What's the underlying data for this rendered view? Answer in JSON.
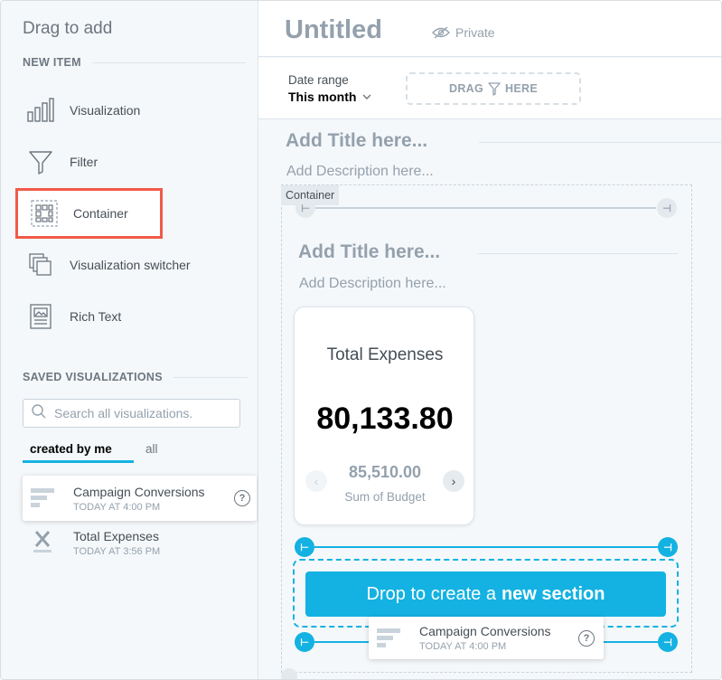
{
  "sidebar": {
    "title": "Drag to add",
    "new_item_heading": "NEW ITEM",
    "items": [
      {
        "label": "Visualization",
        "icon": "bar-chart-icon"
      },
      {
        "label": "Filter",
        "icon": "funnel-icon"
      },
      {
        "label": "Container",
        "icon": "grid-icon"
      },
      {
        "label": "Visualization switcher",
        "icon": "stacked-layers-icon"
      },
      {
        "label": "Rich Text",
        "icon": "rich-text-icon"
      }
    ],
    "saved_heading": "SAVED VISUALIZATIONS",
    "search_placeholder": "Search all visualizations.",
    "tabs": {
      "created_by_me": "created by me",
      "all": "all"
    },
    "saved_items": [
      {
        "name": "Campaign Conversions",
        "time": "TODAY AT 4:00 PM",
        "icon": "bar-chart-horizontal-icon"
      },
      {
        "name": "Total Expenses",
        "time": "TODAY AT 3:56 PM",
        "icon": "headline-x-icon"
      }
    ],
    "help_glyph": "?"
  },
  "header": {
    "title": "Untitled",
    "private_label": "Private"
  },
  "filter_bar": {
    "date_range_label": "Date range",
    "date_range_value": "This month",
    "drag_here_left": "DRAG",
    "drag_here_right": "HERE"
  },
  "section": {
    "title_placeholder": "Add Title here...",
    "description_placeholder": "Add Description here..."
  },
  "container": {
    "label": "Container",
    "title_placeholder": "Add Title here...",
    "description_placeholder": "Add Description here..."
  },
  "kpi": {
    "title": "Total Expenses",
    "value": "80,133.80",
    "previous_value": "85,510.00",
    "previous_label": "Sum of Budget"
  },
  "drop": {
    "text_prefix": "Drop to create a",
    "text_bold": "new section"
  },
  "dragging": {
    "name": "Campaign Conversions",
    "time": "TODAY AT 4:00 PM"
  },
  "colors": {
    "accent": "#14b2e2",
    "highlight": "#f2594a",
    "muted": "#94a1ad"
  }
}
